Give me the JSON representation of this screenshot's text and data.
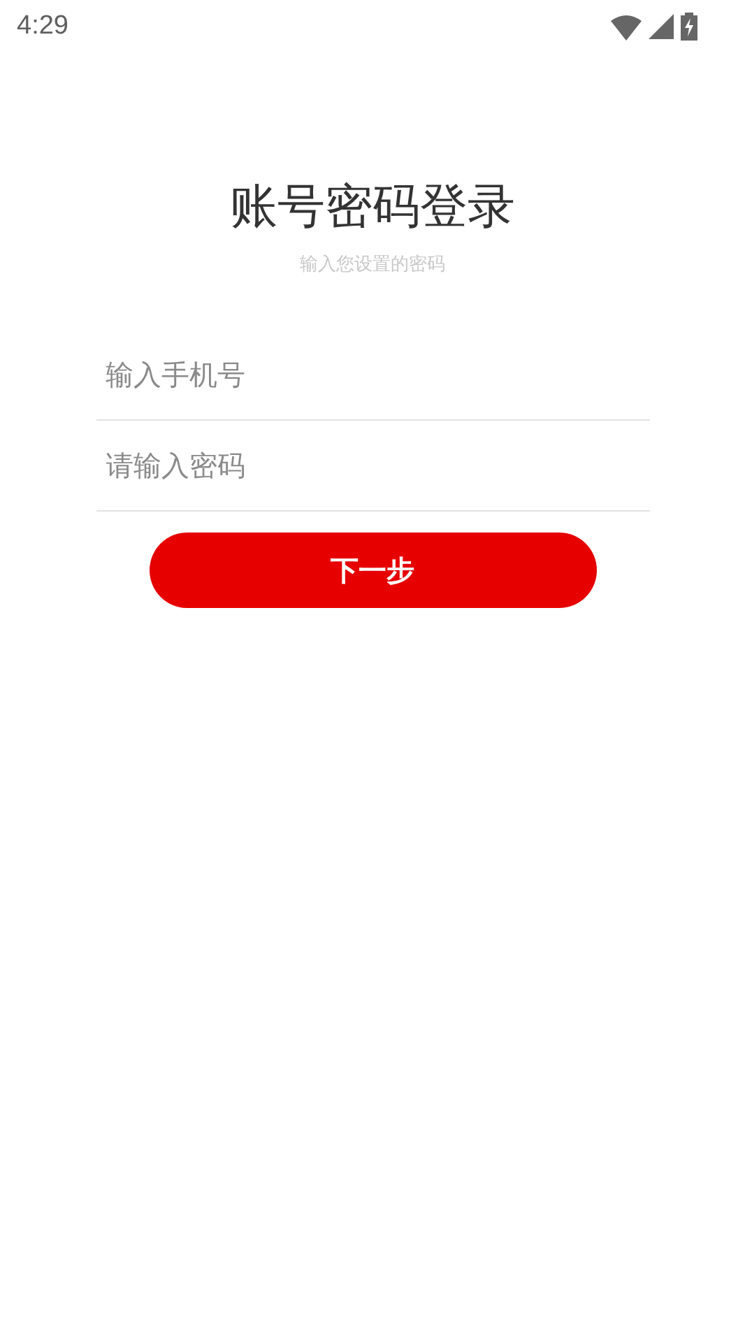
{
  "status_bar": {
    "time": "4:29"
  },
  "title": "账号密码登录",
  "subtitle": "输入您设置的密码",
  "fields": [
    {
      "placeholder": "输入手机号"
    },
    {
      "placeholder": "请输入密码"
    }
  ],
  "button": "下一步"
}
